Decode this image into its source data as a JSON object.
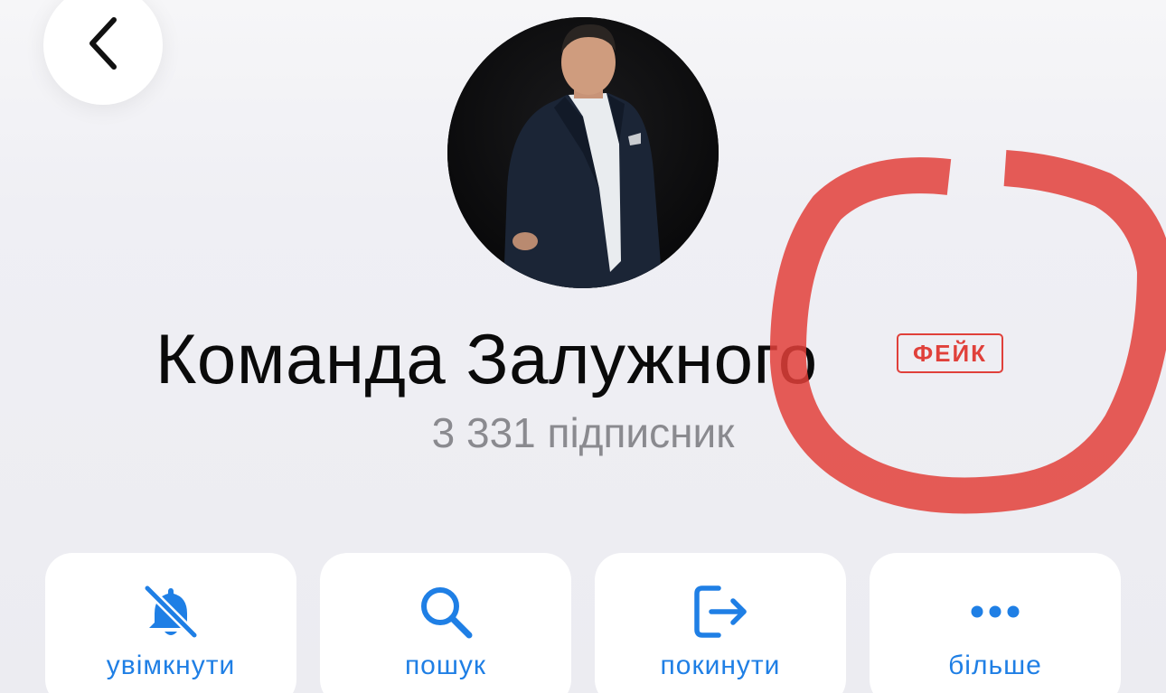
{
  "header": {
    "back_icon": "chevron-left-icon"
  },
  "channel": {
    "name": "Команда Залужного",
    "badge": "ФЕЙК",
    "subscribers": "3 331 підписник",
    "badge_color": "#e0403a"
  },
  "annotation": {
    "color": "#e2403a"
  },
  "actions": [
    {
      "label": "увімкнути",
      "icon": "bell-slash-icon"
    },
    {
      "label": "пошук",
      "icon": "search-icon"
    },
    {
      "label": "покинути",
      "icon": "leave-icon"
    },
    {
      "label": "більше",
      "icon": "more-icon"
    }
  ],
  "colors": {
    "accent": "#1f7fe5",
    "background": "#efeff4",
    "muted_text": "#8a8a8f"
  }
}
